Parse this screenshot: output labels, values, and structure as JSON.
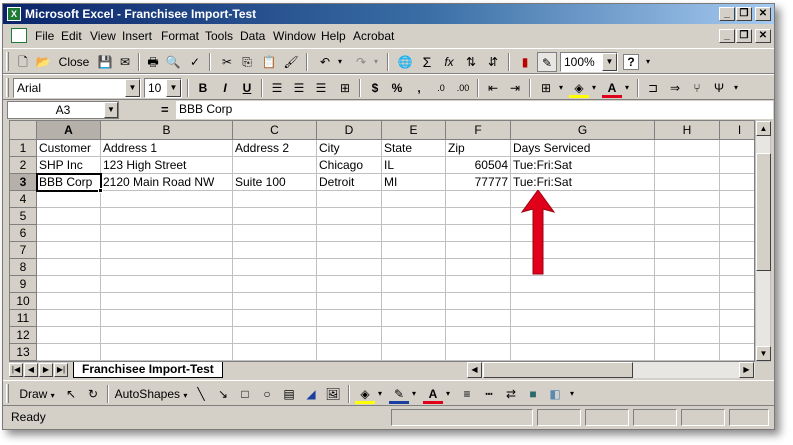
{
  "window": {
    "title": "Microsoft Excel - Franchisee Import-Test",
    "minimize": "_",
    "restore": "❐",
    "close": "✕"
  },
  "menubar": {
    "items": [
      "File",
      "Edit",
      "View",
      "Insert",
      "Format",
      "Tools",
      "Data",
      "Window",
      "Help",
      "Acrobat"
    ],
    "close_label": "Close",
    "doc_minimize": "_",
    "doc_restore": "❐",
    "doc_close": "✕"
  },
  "toolbar": {
    "zoom": "100%",
    "sum": "Σ",
    "fx": "fx",
    "help": "?"
  },
  "format_toolbar": {
    "font": "Arial",
    "size": "10",
    "bold": "B",
    "italic": "I",
    "underline": "U",
    "currency": "$",
    "percent": "%",
    "comma": ","
  },
  "formula_bar": {
    "name_box": "A3",
    "equals": "=",
    "content": "BBB Corp"
  },
  "sheet": {
    "columns": [
      "A",
      "B",
      "C",
      "D",
      "E",
      "F",
      "G",
      "H",
      "I"
    ],
    "rows": [
      "1",
      "2",
      "3",
      "4",
      "5",
      "6",
      "7",
      "8",
      "9",
      "10",
      "11",
      "12",
      "13"
    ],
    "data": [
      [
        "Customer",
        "Address 1",
        "Address 2",
        "City",
        "State",
        "Zip",
        "Days Serviced"
      ],
      [
        "SHP Inc",
        "123 High Street",
        "",
        "Chicago",
        "IL",
        "60504",
        "Tue:Fri:Sat"
      ],
      [
        "BBB Corp",
        "2120 Main Road NW",
        "Suite 100",
        "Detroit",
        "MI",
        "77777",
        "Tue:Fri:Sat"
      ]
    ],
    "active_cell": "A3",
    "tab_name": "Franchisee Import-Test"
  },
  "drawing_toolbar": {
    "draw": "Draw",
    "autoshapes": "AutoShapes"
  },
  "status": {
    "text": "Ready"
  },
  "colors": {
    "title_start": "#0a246a",
    "title_end": "#a6caf0",
    "chrome": "#d4d0c8",
    "arrow": "#e0001a"
  }
}
